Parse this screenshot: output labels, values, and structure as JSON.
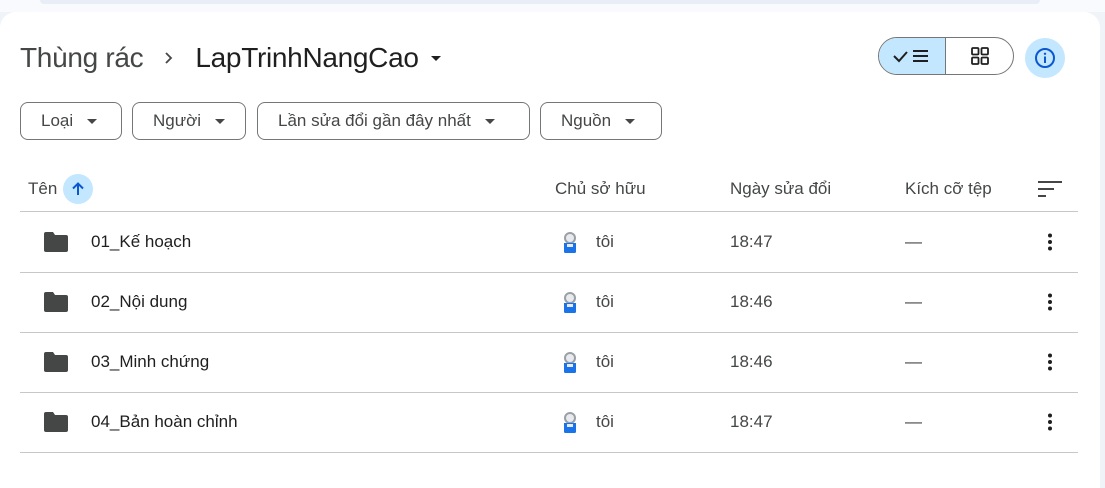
{
  "breadcrumb": {
    "root": "Thùng rác",
    "current": "LapTrinhNangCao"
  },
  "view_toggle": {
    "list_icon": "check-list-icon",
    "grid_icon": "grid-icon",
    "selected": "list"
  },
  "info_icon": "info-icon",
  "filters": [
    {
      "label": "Loại"
    },
    {
      "label": "Người"
    },
    {
      "label": "Lần sửa đổi gần đây nhất"
    },
    {
      "label": "Nguồn"
    }
  ],
  "columns": {
    "name": "Tên",
    "owner": "Chủ sở hữu",
    "modified": "Ngày sửa đổi",
    "size": "Kích cỡ tệp"
  },
  "rows": [
    {
      "name": "01_Kế hoạch",
      "owner": "tôi",
      "modified": "18:47",
      "size": "—"
    },
    {
      "name": "02_Nội dung",
      "owner": "tôi",
      "modified": "18:46",
      "size": "—"
    },
    {
      "name": "03_Minh chứng",
      "owner": "tôi",
      "modified": "18:46",
      "size": "—"
    },
    {
      "name": "04_Bản hoàn chỉnh",
      "owner": "tôi",
      "modified": "18:47",
      "size": "—"
    }
  ],
  "colors": {
    "accent": "#c2e7ff",
    "accent_icon": "#0b57d0",
    "text": "#1f1f1f",
    "muted": "#444746",
    "divider": "#c7c7c7"
  }
}
